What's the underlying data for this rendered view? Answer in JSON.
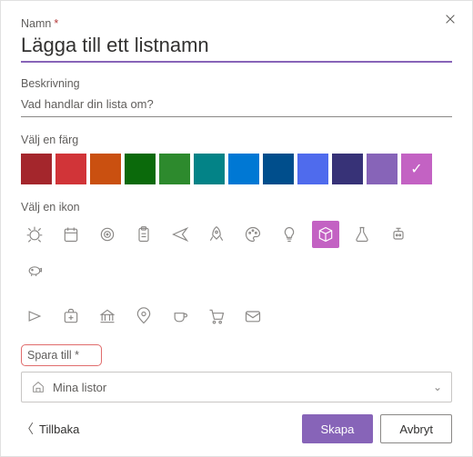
{
  "labels": {
    "name": "Namn",
    "required_mark": "*",
    "description": "Beskrivning",
    "choose_color": "Välj en färg",
    "choose_icon": "Välj en ikon",
    "save_to": "Spara till *"
  },
  "name_field": {
    "placeholder": "Lägga till ett listnamn",
    "value": ""
  },
  "description_field": {
    "placeholder": "Vad handlar din lista om?",
    "value": ""
  },
  "colors": [
    {
      "name": "dark-red",
      "hex": "#a4262c",
      "selected": false
    },
    {
      "name": "red",
      "hex": "#d13438",
      "selected": false
    },
    {
      "name": "orange",
      "hex": "#ca5010",
      "selected": false
    },
    {
      "name": "green",
      "hex": "#0b6a0b",
      "selected": false
    },
    {
      "name": "bright-green",
      "hex": "#2d8a2d",
      "selected": false
    },
    {
      "name": "teal",
      "hex": "#038387",
      "selected": false
    },
    {
      "name": "blue",
      "hex": "#0078d4",
      "selected": false
    },
    {
      "name": "dark-blue",
      "hex": "#004e8c",
      "selected": false
    },
    {
      "name": "indigo",
      "hex": "#4f6bed",
      "selected": false
    },
    {
      "name": "dark-purple",
      "hex": "#373277",
      "selected": false
    },
    {
      "name": "purple",
      "hex": "#8764b8",
      "selected": false
    },
    {
      "name": "pink",
      "hex": "#c362c3",
      "selected": true
    }
  ],
  "icons_row1": [
    "bug",
    "calendar",
    "target",
    "clipboard",
    "airplane",
    "rocket",
    "palette",
    "lightbulb",
    "cube",
    "flask",
    "robot",
    "piggybank"
  ],
  "icons_row2": [
    "playlist",
    "firstaid",
    "bank",
    "location",
    "coffee",
    "cart",
    "mail"
  ],
  "selected_icon": "cube",
  "save_to": {
    "selected": "Mina listor"
  },
  "footer": {
    "back": "Tillbaka",
    "create": "Skapa",
    "cancel": "Avbryt"
  }
}
